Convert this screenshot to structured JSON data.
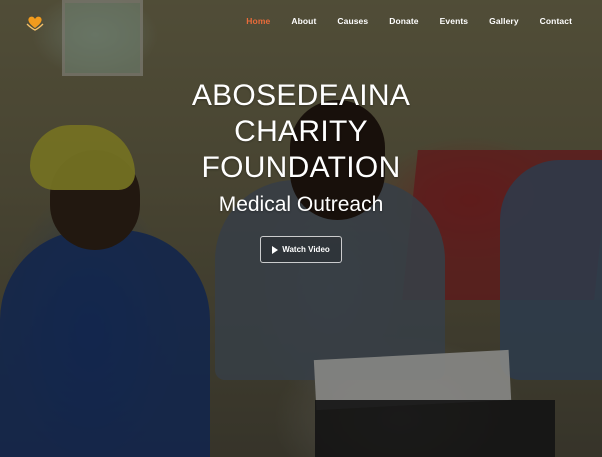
{
  "nav": {
    "items": [
      {
        "label": "Home",
        "active": true
      },
      {
        "label": "About",
        "active": false
      },
      {
        "label": "Causes",
        "active": false
      },
      {
        "label": "Donate",
        "active": false
      },
      {
        "label": "Events",
        "active": false
      },
      {
        "label": "Gallery",
        "active": false
      },
      {
        "label": "Contact",
        "active": false
      }
    ],
    "active_color": "#e96b3a"
  },
  "logo": {
    "icon": "heart-hands-logo-icon",
    "color": "#f29b1d"
  },
  "hero": {
    "title": "ABOSEDEAINA CHARITY FOUNDATION",
    "subtitle": "Medical Outreach",
    "button_label": "Watch Video",
    "button_icon": "play-icon"
  }
}
